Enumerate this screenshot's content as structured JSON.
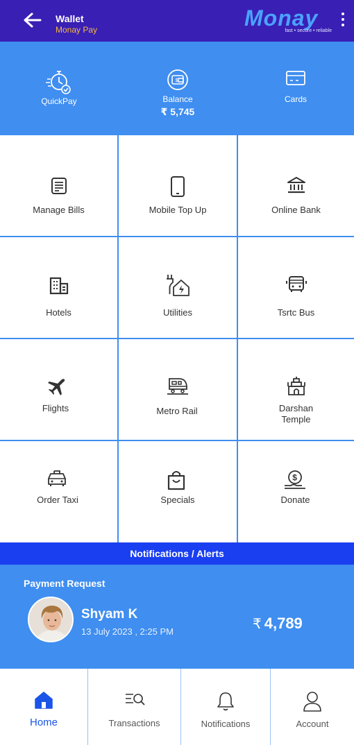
{
  "header": {
    "title": "Wallet",
    "subtitle": "Monay Pay",
    "brand_name": "Monay",
    "brand_tagline": "fast • secure • reliable"
  },
  "top_actions": [
    {
      "label": "QuickPay",
      "icon": "quickpay-icon"
    },
    {
      "label": "Balance",
      "amount": "₹ 5,745",
      "icon": "wallet-balance-icon"
    },
    {
      "label": "Cards",
      "icon": "card-icon"
    }
  ],
  "services": [
    {
      "label": "Manage Bills",
      "icon": "bill-receipt-icon"
    },
    {
      "label": "Mobile Top Up",
      "icon": "mobile-phone-icon"
    },
    {
      "label": "Online Bank",
      "icon": "bank-icon"
    },
    {
      "label": "Hotels",
      "icon": "hotel-building-icon"
    },
    {
      "label": "Utilities",
      "icon": "utilities-house-plug-icon"
    },
    {
      "label": "Tsrtc Bus",
      "icon": "bus-icon"
    },
    {
      "label": "Flights",
      "icon": "airplane-icon"
    },
    {
      "label": "Metro Rail",
      "icon": "metro-train-icon"
    },
    {
      "label": "Darshan",
      "label2": "Temple",
      "icon": "temple-icon"
    },
    {
      "label": "Order Taxi",
      "icon": "taxi-icon"
    },
    {
      "label": "Specials",
      "icon": "shopping-bag-icon"
    },
    {
      "label": "Donate",
      "icon": "donate-coin-hand-icon"
    }
  ],
  "notifications_bar": "Notifications / Alerts",
  "payment_request": {
    "title": "Payment Request",
    "name": "Shyam K",
    "date": "13 July 2023 , 2:25 PM",
    "currency_symbol": "₹",
    "amount": "4,789"
  },
  "bottom_nav": [
    {
      "label": "Home",
      "icon": "home-icon",
      "active": true
    },
    {
      "label": "Transactions",
      "icon": "transactions-search-icon"
    },
    {
      "label": "Notifications",
      "icon": "bell-icon"
    },
    {
      "label": "Account",
      "icon": "user-icon"
    }
  ],
  "colors": {
    "header_bg": "#3a1fb5",
    "accent_blue": "#3f8ef0",
    "alert_bar": "#1a3ff0",
    "subtitle_gold": "#f5b83d",
    "active_nav": "#1a55e8"
  }
}
